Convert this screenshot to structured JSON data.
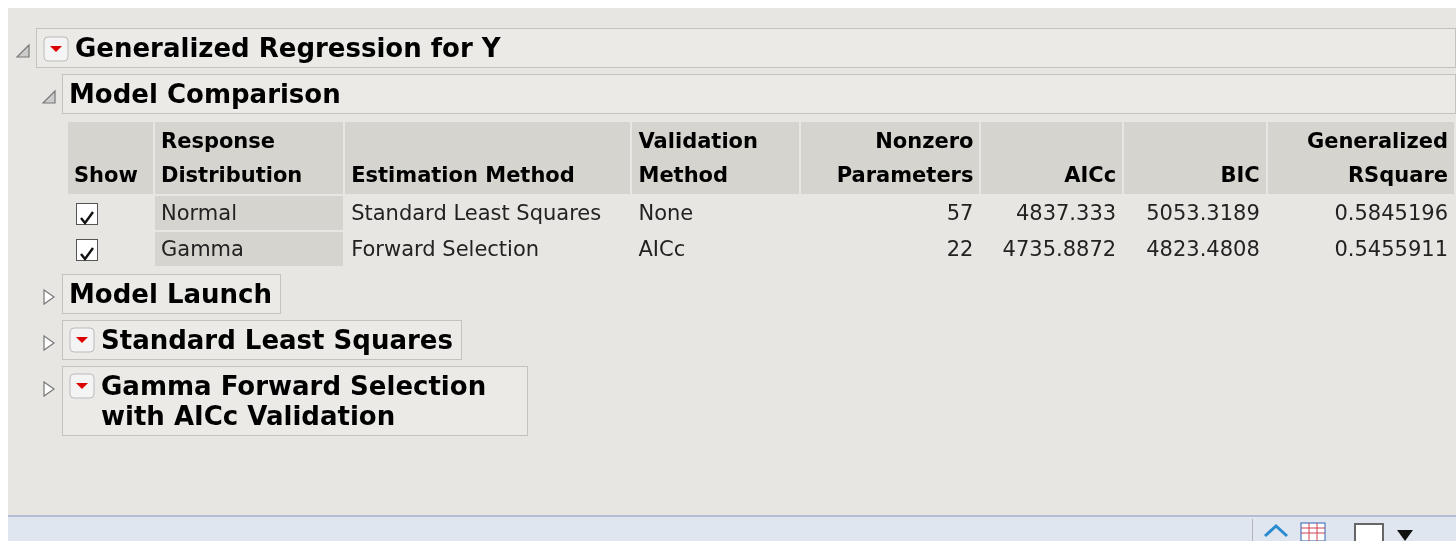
{
  "report": {
    "title": "Generalized Regression for Y",
    "expanded": true,
    "menu": true
  },
  "sections": [
    {
      "title": "Model Comparison",
      "expanded": true,
      "menu": false,
      "table": {
        "columns": [
          {
            "label": "Show",
            "kind": "text"
          },
          {
            "label": "Response Distribution",
            "kind": "text"
          },
          {
            "label": "Estimation Method",
            "kind": "text"
          },
          {
            "label": "Validation Method",
            "kind": "text"
          },
          {
            "label": "Nonzero Parameters",
            "kind": "number"
          },
          {
            "label": "AICc",
            "kind": "number"
          },
          {
            "label": "BIC",
            "kind": "number"
          },
          {
            "label": "Generalized RSquare",
            "kind": "number"
          }
        ],
        "rows": [
          {
            "cells": [
              {
                "checked": true
              },
              "Normal",
              "Standard Least Squares",
              "None",
              "57",
              "4837.333",
              "5053.3189",
              "0.5845196"
            ]
          },
          {
            "cells": [
              {
                "checked": true
              },
              "Gamma",
              "Forward Selection",
              "AICc",
              "22",
              "4735.8872",
              "4823.4808",
              "0.5455911"
            ]
          }
        ]
      }
    },
    {
      "title": "Model Launch",
      "expanded": false,
      "menu": false
    },
    {
      "title": "Standard Least Squares",
      "expanded": false,
      "menu": true
    },
    {
      "title": "Gamma Forward Selection with AICc Validation",
      "expanded": false,
      "menu": true
    }
  ]
}
